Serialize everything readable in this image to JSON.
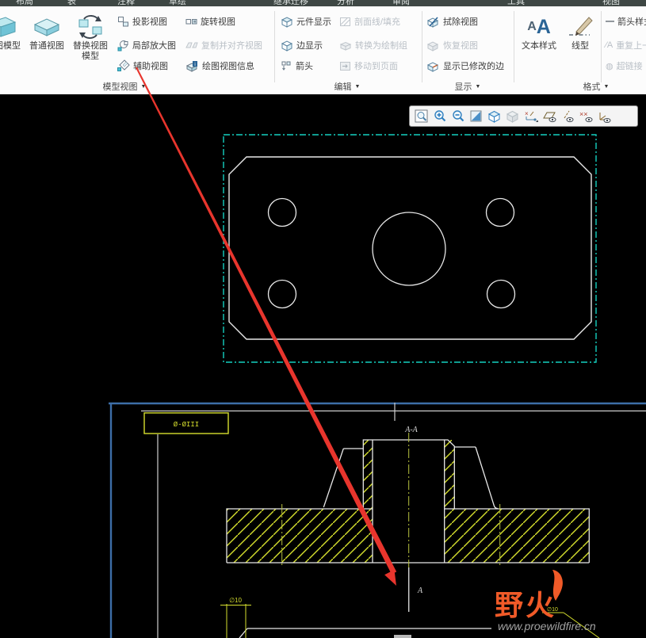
{
  "menu_bar": {
    "tabs": [
      {
        "label": "布局"
      },
      {
        "label": "表"
      },
      {
        "label": "注释"
      },
      {
        "label": "草绘"
      },
      {
        "label": "继承迁移"
      },
      {
        "label": "分析"
      },
      {
        "label": "审阅"
      },
      {
        "label": "工具"
      },
      {
        "label": "视图"
      }
    ]
  },
  "ribbon": {
    "model_views": {
      "group_label": "模型视图",
      "drawing_model": "绘图模型",
      "general_view": "普通视图",
      "replace_view_model": "替换视图模型",
      "projection_view": "投影视图",
      "detailed_view": "局部放大图",
      "auxiliary_view": "辅助视图",
      "rotated_view": "旋转视图",
      "copy_align_view": "复制并对齐视图",
      "drawing_view_info": "绘图视图信息"
    },
    "edit": {
      "group_label": "编辑",
      "component_display": "元件显示",
      "edge_display": "边显示",
      "arrows": "箭头",
      "hatch_fill": "剖面线/填充",
      "convert_to_draft_group": "转换为绘制组",
      "move_to_sheet": "移动到页面"
    },
    "display": {
      "group_label": "显示",
      "erase_view": "拭除视图",
      "resume_view": "恢复视图",
      "show_modified_edges": "显示已修改的边"
    },
    "format": {
      "group_label": "格式",
      "text_style": "文本样式",
      "line_style": "线型",
      "arrow_style": "箭头样式",
      "repeat_last_format": "重复上一格式",
      "hyperlink": "超链接"
    }
  },
  "icon_glyphs": {
    "dropdown": "▼",
    "text_style_a1": "A",
    "text_style_a2": "A",
    "arrow_style_dash": "—",
    "repeat_format": "⁄A",
    "hyperlink_globe": "◍"
  },
  "view_toolbar": {
    "icons": [
      "zoom-box",
      "zoom-in",
      "zoom-out",
      "repaint",
      "display-style",
      "saved-views",
      "datum-display-filter",
      "plane-display",
      "axis-display",
      "point-display",
      "csys-display"
    ]
  },
  "drawing": {
    "sheet_label": "Ø-ØIII",
    "section_label": "A-A",
    "section_arrow_label": "A",
    "dim_left": "∅10",
    "dim_right": "∅10",
    "logo_text": "野火",
    "watermark_url": "www.proewildfire.cn"
  },
  "colors": {
    "selection_cyan": "#14cfc0",
    "hatch_yellow": "#d6df2e",
    "centerline_olive": "#b9c23f",
    "arrow_red": "#e8352d",
    "sheet_blue": "#3d6ea8",
    "logo_orange": "#f05a28",
    "geometry_white": "#e8e8e8"
  }
}
